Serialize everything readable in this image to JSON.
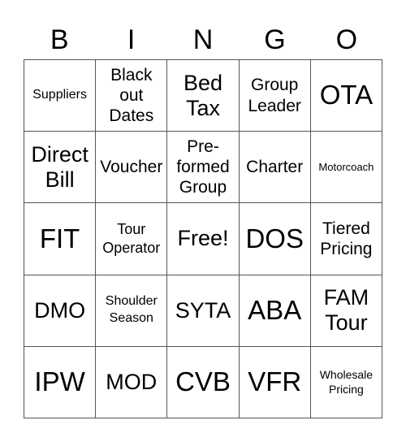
{
  "header": [
    "B",
    "I",
    "N",
    "G",
    "O"
  ],
  "cells": [
    {
      "text": "Suppliers",
      "size": "s-s"
    },
    {
      "text": "Black out Dates",
      "size": "s-m",
      "lines": [
        "Black",
        "out",
        "Dates"
      ]
    },
    {
      "text": "Bed Tax",
      "size": "s-l",
      "lines": [
        "Bed",
        "Tax"
      ]
    },
    {
      "text": "Group Leader",
      "size": "s-m",
      "lines": [
        "Group",
        "Leader"
      ]
    },
    {
      "text": "OTA",
      "size": "s-xl"
    },
    {
      "text": "Direct Bill",
      "size": "s-l",
      "lines": [
        "Direct",
        "Bill"
      ]
    },
    {
      "text": "Voucher",
      "size": "s-m"
    },
    {
      "text": "Pre-formed Group",
      "size": "s-m",
      "lines": [
        "Pre-",
        "formed",
        "Group"
      ]
    },
    {
      "text": "Charter",
      "size": "s-m"
    },
    {
      "text": "Motorcoach",
      "size": "s-xxs"
    },
    {
      "text": "FIT",
      "size": "s-xl"
    },
    {
      "text": "Tour Operator",
      "size": "s-sm",
      "lines": [
        "Tour",
        "Operator"
      ]
    },
    {
      "text": "Free!",
      "size": "s-l"
    },
    {
      "text": "DOS",
      "size": "s-xl"
    },
    {
      "text": "Tiered Pricing",
      "size": "s-m",
      "lines": [
        "Tiered",
        "Pricing"
      ]
    },
    {
      "text": "DMO",
      "size": "s-l"
    },
    {
      "text": "Shoulder Season",
      "size": "s-s",
      "lines": [
        "Shoulder",
        "Season"
      ]
    },
    {
      "text": "SYTA",
      "size": "s-l"
    },
    {
      "text": "ABA",
      "size": "s-xl"
    },
    {
      "text": "FAM Tour",
      "size": "s-l",
      "lines": [
        "FAM",
        "Tour"
      ]
    },
    {
      "text": "IPW",
      "size": "s-xl"
    },
    {
      "text": "MOD",
      "size": "s-l"
    },
    {
      "text": "CVB",
      "size": "s-xl"
    },
    {
      "text": "VFR",
      "size": "s-xl"
    },
    {
      "text": "Wholesale Pricing",
      "size": "s-xs",
      "lines": [
        "Wholesale",
        "Pricing"
      ]
    }
  ]
}
